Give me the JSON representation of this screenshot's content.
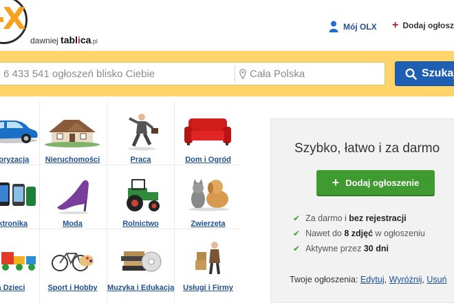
{
  "header": {
    "tagline_prefix": "dawniej",
    "brand_pre": "tabl",
    "brand_i": "i",
    "brand_post": "ca",
    "brand_suffix": ".pl",
    "my_account": "Mój OLX",
    "post_ad": "Dodaj ogłoszenie"
  },
  "search": {
    "placeholder": "6 433 541 ogłoszeń blisko Ciebie",
    "location": "Cała Polska",
    "button": "Szukaj"
  },
  "categories": [
    {
      "label": "Motoryzacja",
      "icon": "car-icon"
    },
    {
      "label": "Nieruchomości",
      "icon": "house-icon"
    },
    {
      "label": "Praca",
      "icon": "businessman-icon"
    },
    {
      "label": "Dom i Ogród",
      "icon": "sofa-icon"
    },
    {
      "label": "Elektronika",
      "icon": "phones-icon"
    },
    {
      "label": "Moda",
      "icon": "high-heel-icon"
    },
    {
      "label": "Rolnictwo",
      "icon": "tractor-icon"
    },
    {
      "label": "Zwierzęta",
      "icon": "cat-dog-icon"
    },
    {
      "label": "Dla Dzieci",
      "icon": "toy-train-icon"
    },
    {
      "label": "Sport i Hobby",
      "icon": "bicycle-icon"
    },
    {
      "label": "Muzyka i Edukacja",
      "icon": "books-icon"
    },
    {
      "label": "Usługi i Firmy",
      "icon": "delivery-man-icon"
    }
  ],
  "promo": {
    "title": "Szybko, łatwo i za darmo",
    "button": "Dodaj ogłoszenie",
    "features": [
      {
        "pre": "Za darmo i ",
        "bold": "bez rejestracji",
        "post": ""
      },
      {
        "pre": "Nawet do ",
        "bold": "8 zdjęć",
        "post": " w ogłoszeniu"
      },
      {
        "pre": "Aktywne przez ",
        "bold": "30 dni",
        "post": ""
      }
    ],
    "your_ads_label": "Twoje ogłoszenia:",
    "your_ads_links": [
      "Edytuj",
      "Wyróżnij",
      "Usuń"
    ]
  },
  "colors": {
    "band": "#fed46b",
    "link": "#1d4f91",
    "search_button": "#1f5fb3",
    "add_button": "#3f9a2f",
    "logo_accent": "#f8a11f",
    "accent_red": "#c4161c"
  }
}
